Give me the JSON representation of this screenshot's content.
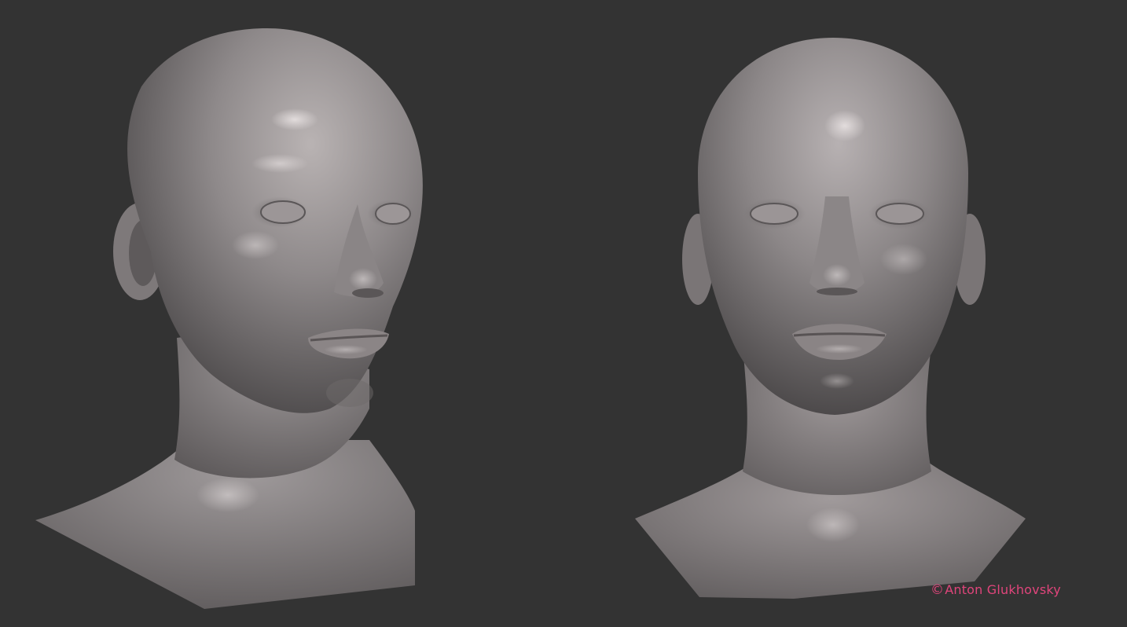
{
  "scene": {
    "background_color": "#333333",
    "clay_color": "#8f8a8b",
    "subjects": [
      {
        "name": "three-quarter view"
      },
      {
        "name": "front view"
      }
    ]
  },
  "credit": {
    "symbol": "©",
    "text": "Anton Glukhovsky",
    "color": "#e0457b"
  }
}
